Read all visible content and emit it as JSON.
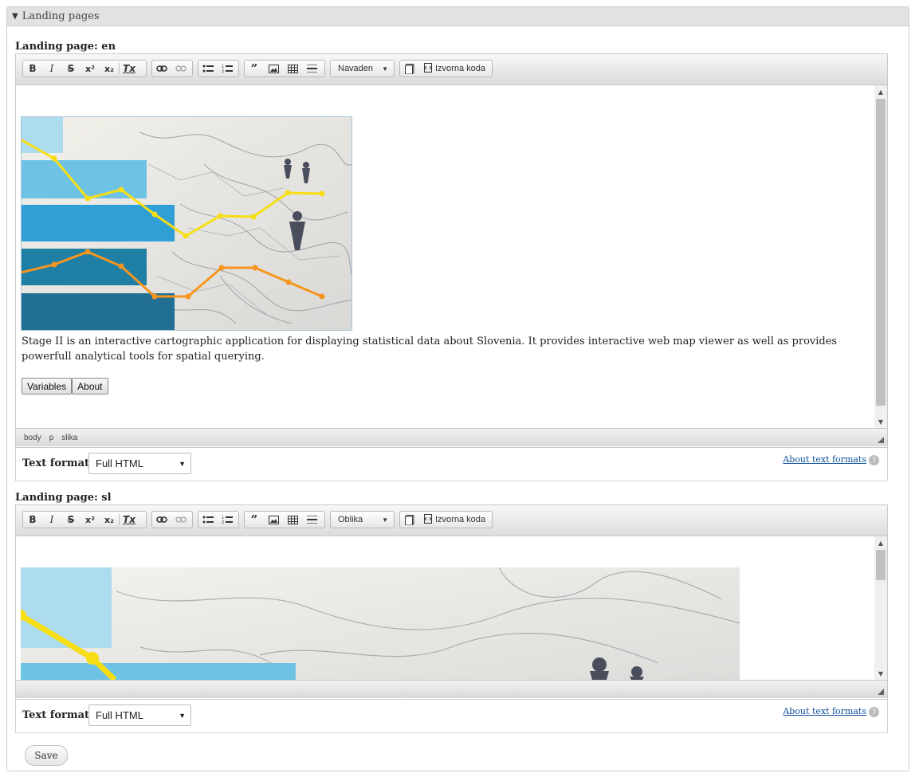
{
  "fieldset": {
    "title": "Landing pages",
    "toggle_icon": "triangle-down-icon"
  },
  "toolbar": {
    "bold": "B",
    "italic": "I",
    "strike": "S",
    "sup": "x²",
    "sub": "x₂",
    "clear": "Tx",
    "source_label": "Izvorna koda"
  },
  "editor_en": {
    "label": "Landing page: en",
    "style_combo": "Navaden",
    "description": "Stage II is an interactive cartographic application for displaying statistical data about Slovenia. It provides interactive web map viewer as well as provides powerfull analytical tools for spatial querying.",
    "buttons": [
      "Variables",
      "About"
    ],
    "path": [
      "body",
      "p",
      "slika"
    ],
    "text_format_label": "Text format",
    "text_format_value": "Full HTML",
    "about_link": "About text formats"
  },
  "editor_sl": {
    "label": "Landing page: sl",
    "style_combo": "Oblika",
    "text_format_label": "Text format",
    "text_format_value": "Full HTML",
    "about_link": "About text formats"
  },
  "save_label": "Save",
  "colors": {
    "light_blue": "#aedcef",
    "mid_blue": "#6ec3e4",
    "blue": "#2f9fd5",
    "teal": "#1f7fa5",
    "dark_teal": "#226f94",
    "yellow_line": "#f7de14",
    "orange_line": "#f7961e",
    "link": "#0d4e9a"
  }
}
